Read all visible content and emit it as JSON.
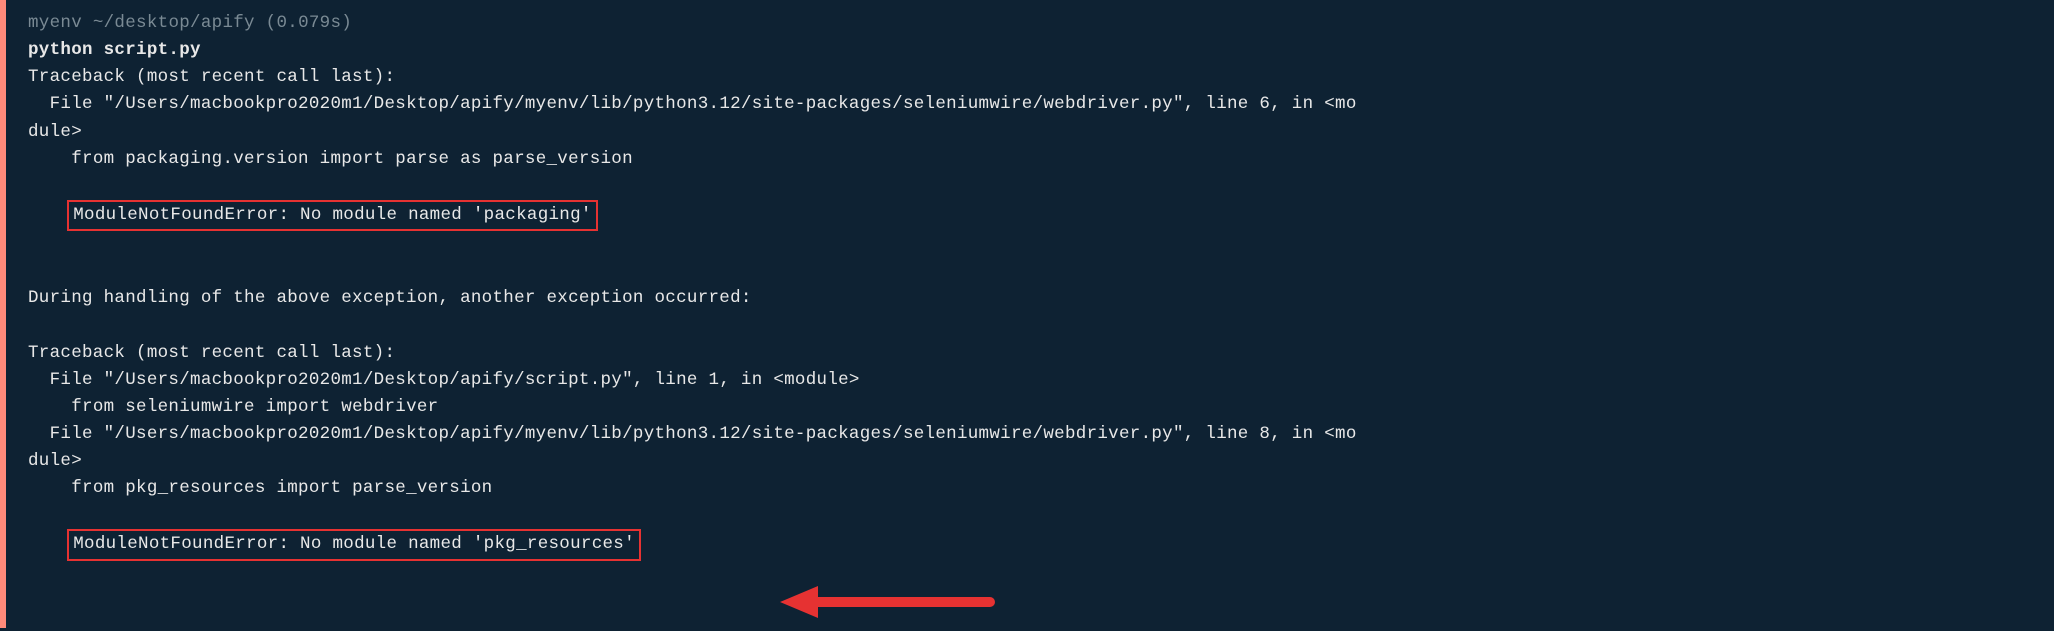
{
  "prompt": {
    "env": "myenv",
    "path": "~/desktop/apify",
    "time": "(0.079s)"
  },
  "command": "python script.py",
  "lines": {
    "tb1_header": "Traceback (most recent call last):",
    "tb1_file": "  File \"/Users/macbookpro2020m1/Desktop/apify/myenv/lib/python3.12/site-packages/seleniumwire/webdriver.py\", line 6, in <mo",
    "tb1_file_wrap": "dule>",
    "tb1_code": "    from packaging.version import parse as parse_version",
    "tb1_error": "ModuleNotFoundError: No module named 'packaging'",
    "between": "During handling of the above exception, another exception occurred:",
    "tb2_header": "Traceback (most recent call last):",
    "tb2_file1": "  File \"/Users/macbookpro2020m1/Desktop/apify/script.py\", line 1, in <module>",
    "tb2_code1": "    from seleniumwire import webdriver",
    "tb2_file2": "  File \"/Users/macbookpro2020m1/Desktop/apify/myenv/lib/python3.12/site-packages/seleniumwire/webdriver.py\", line 8, in <mo",
    "tb2_file2_wrap": "dule>",
    "tb2_code2": "    from pkg_resources import parse_version",
    "tb2_error": "ModuleNotFoundError: No module named 'pkg_resources'"
  },
  "annotations": {
    "arrow_color": "#e63232",
    "highlight_color": "#e63232"
  }
}
